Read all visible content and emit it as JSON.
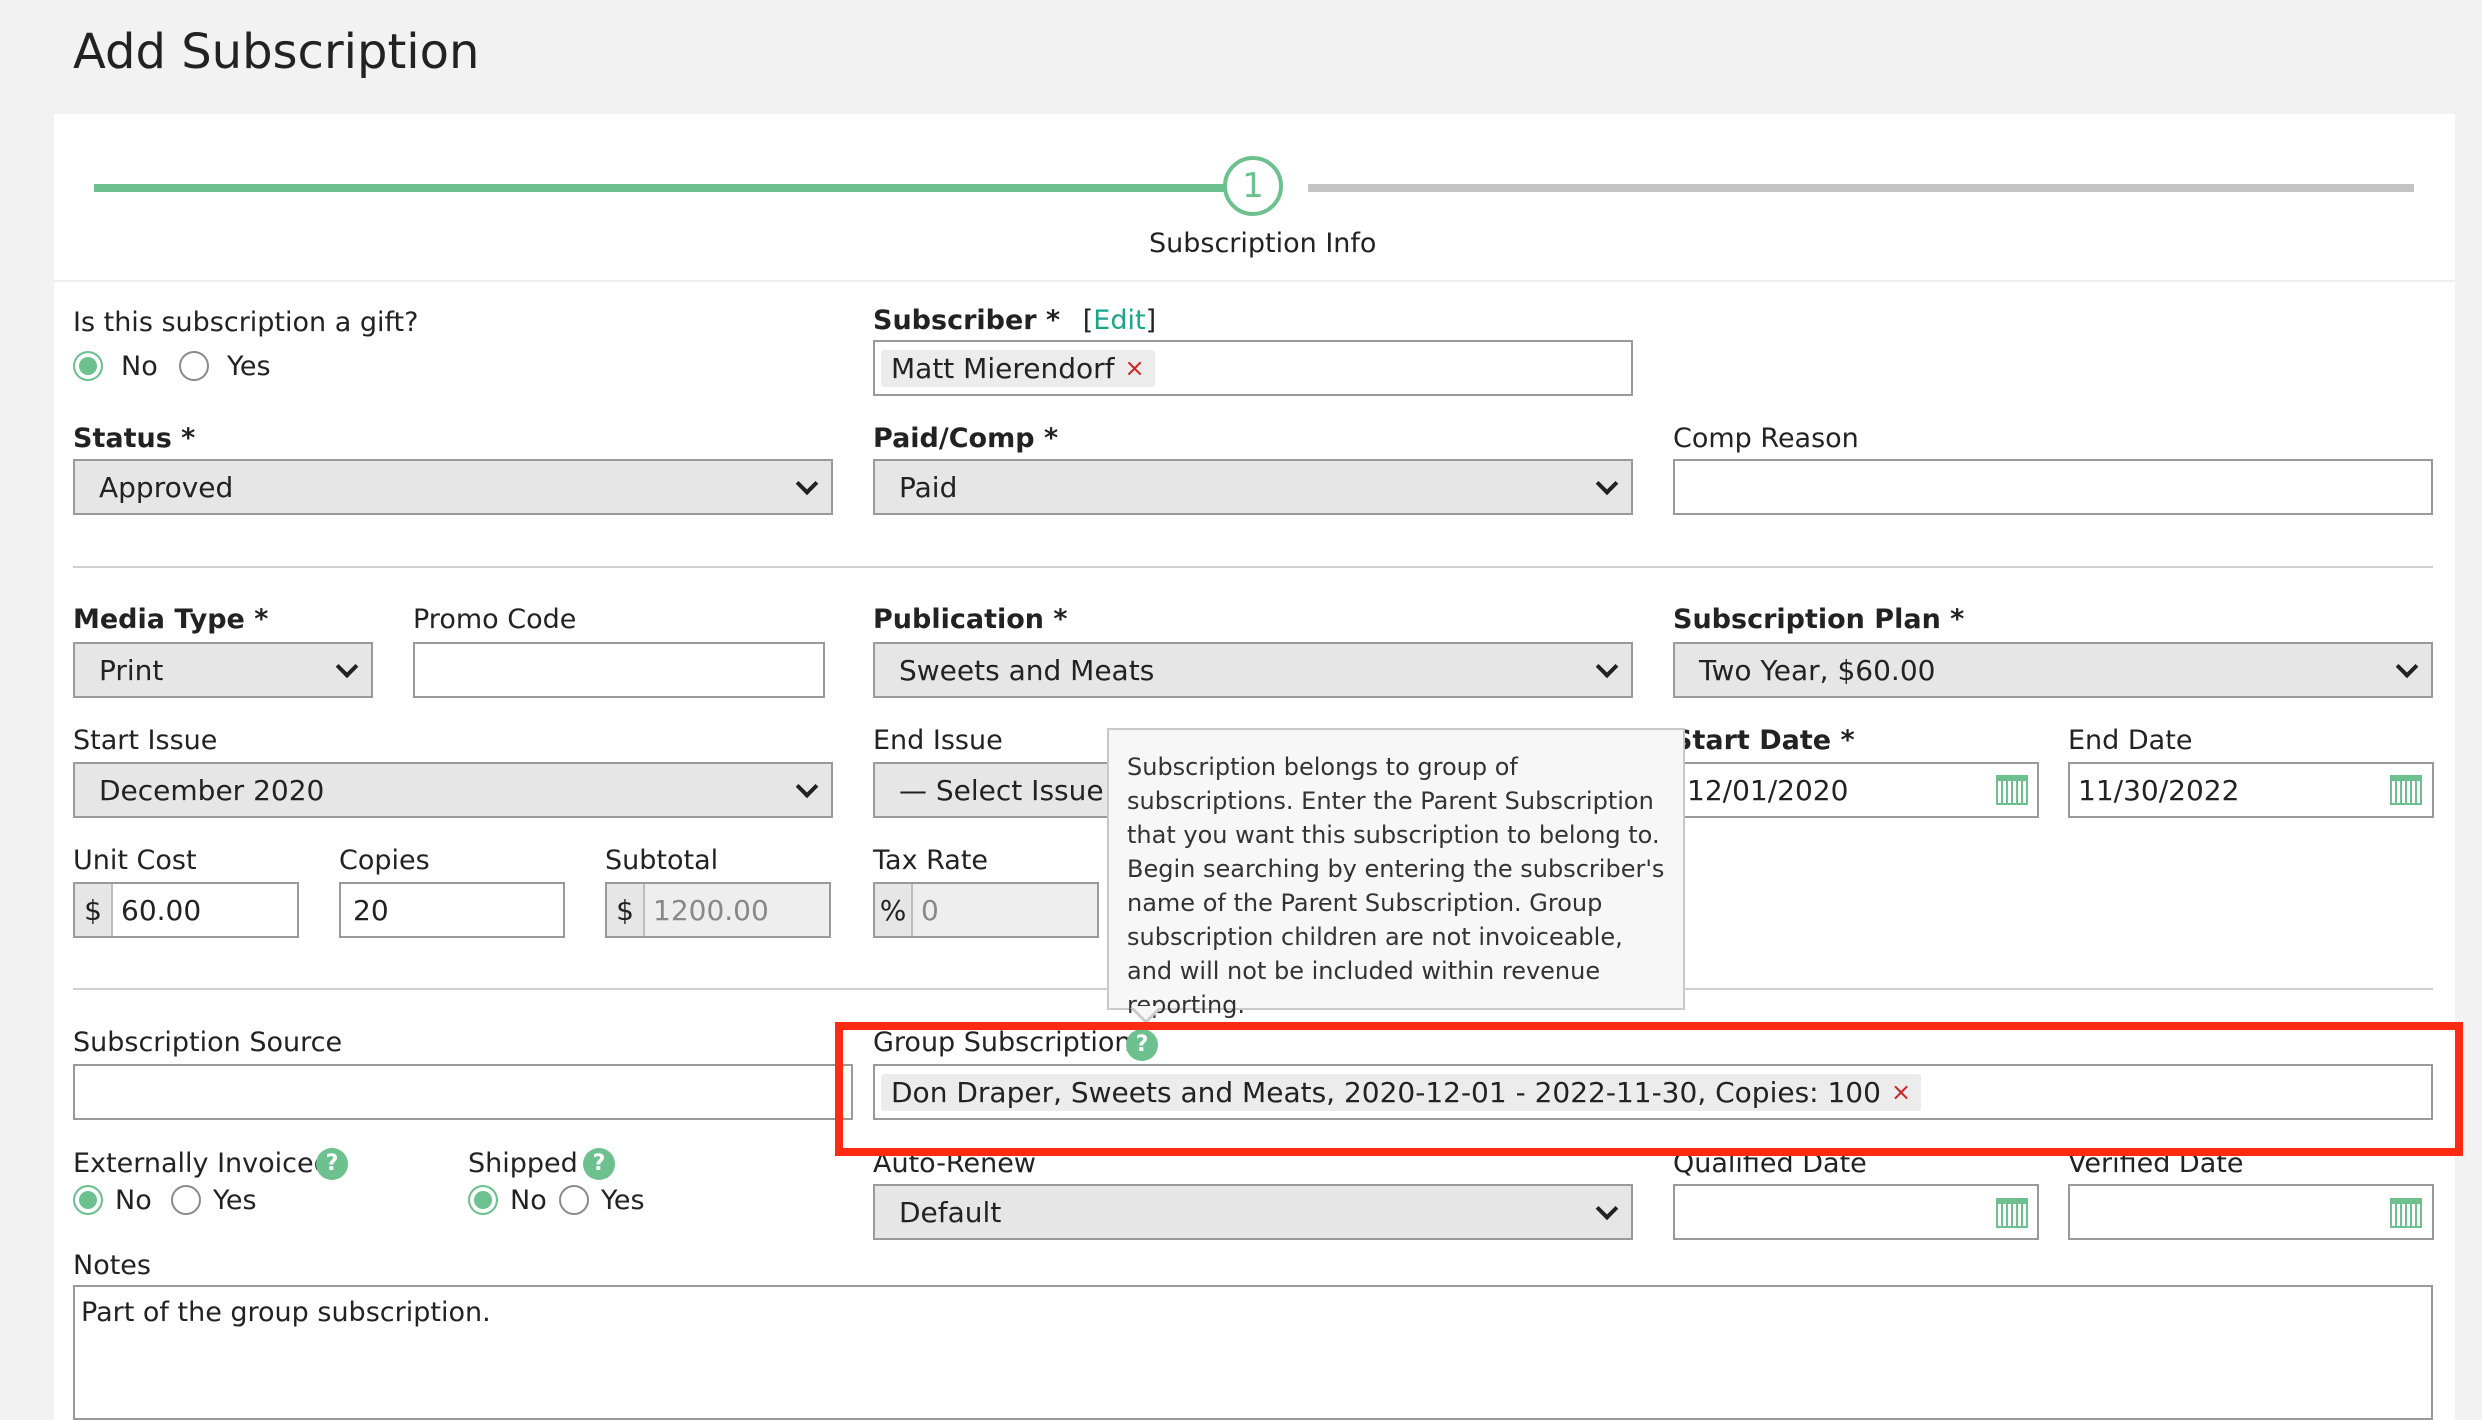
{
  "page": {
    "title": "Add Subscription"
  },
  "steps": [
    {
      "number": "1",
      "label": "Subscription Info"
    }
  ],
  "gift": {
    "label": "Is this subscription a gift?",
    "no": "No",
    "yes": "Yes",
    "selected": "No"
  },
  "subscriber": {
    "label": "Subscriber *",
    "edit_open": "[",
    "edit_label": "Edit",
    "edit_close": "]",
    "value": "Matt Mierendorf",
    "remove": "×"
  },
  "status": {
    "label": "Status *",
    "value": "Approved"
  },
  "paid_comp": {
    "label": "Paid/Comp *",
    "value": "Paid"
  },
  "comp_reason": {
    "label": "Comp Reason",
    "value": ""
  },
  "media_type": {
    "label": "Media Type *",
    "value": "Print"
  },
  "promo_code": {
    "label": "Promo Code",
    "value": ""
  },
  "publication": {
    "label": "Publication *",
    "value": "Sweets and Meats"
  },
  "subscription_plan": {
    "label": "Subscription Plan *",
    "value": "Two Year, $60.00"
  },
  "start_issue": {
    "label": "Start Issue",
    "value": "December 2020"
  },
  "end_issue": {
    "label": "End Issue",
    "value": "— Select Issue —"
  },
  "start_date": {
    "label": "Start Date *",
    "value": "12/01/2020"
  },
  "end_date": {
    "label": "End Date",
    "value": "11/30/2022"
  },
  "unit_cost": {
    "label": "Unit Cost",
    "prefix": "$",
    "value": "60.00"
  },
  "copies": {
    "label": "Copies",
    "value": "20"
  },
  "subtotal": {
    "label": "Subtotal",
    "prefix": "$",
    "value": "1200.00"
  },
  "tax_rate": {
    "label": "Tax Rate",
    "prefix": "%",
    "value": "0"
  },
  "tooltip": {
    "text": "Subscription belongs to group of subscriptions. Enter the Parent Subscription that you want this subscription to belong to. Begin searching by entering the subscriber's name of the Parent Subscription. Group subscription children are not invoiceable, and will not be included within revenue reporting."
  },
  "subscription_source": {
    "label": "Subscription Source",
    "value": ""
  },
  "group_subscription": {
    "label": "Group Subscription",
    "help": "?",
    "value": "Don Draper, Sweets and Meats, 2020-12-01 - 2022-11-30, Copies: 100",
    "remove": "×"
  },
  "externally_invoiced": {
    "label": "Externally Invoiced",
    "help": "?",
    "no": "No",
    "yes": "Yes",
    "selected": "No"
  },
  "shipped": {
    "label": "Shipped",
    "help": "?",
    "no": "No",
    "yes": "Yes",
    "selected": "No"
  },
  "auto_renew": {
    "label": "Auto-Renew",
    "value": "Default"
  },
  "qualified_date": {
    "label": "Qualified Date",
    "value": ""
  },
  "verified_date": {
    "label": "Verified Date",
    "value": ""
  },
  "notes": {
    "label": "Notes",
    "value": "Part of the group subscription."
  },
  "colors": {
    "accent": "#6cc18e",
    "highlight": "#ff2a12",
    "link": "#1aa58a",
    "remove": "#cc2222"
  }
}
